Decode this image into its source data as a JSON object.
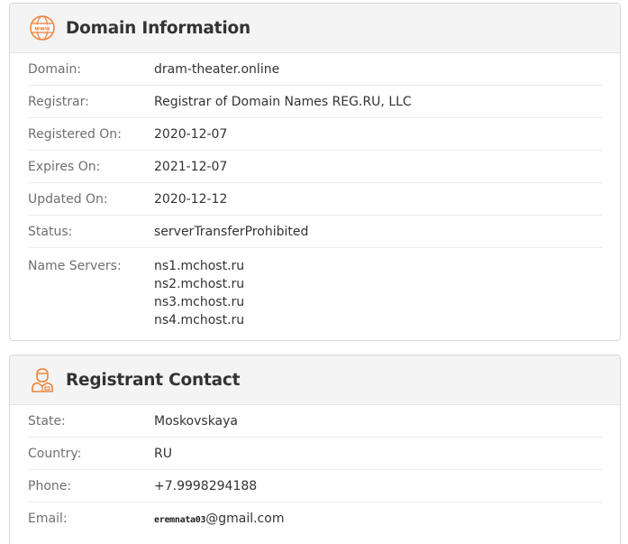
{
  "domain_card": {
    "title": "Domain Information",
    "icon": "www-globe-icon",
    "rows": [
      {
        "label": "Domain:",
        "value": "dram-theater.online"
      },
      {
        "label": "Registrar:",
        "value": "Registrar of Domain Names REG.RU, LLC"
      },
      {
        "label": "Registered On:",
        "value": "2020-12-07"
      },
      {
        "label": "Expires On:",
        "value": "2021-12-07"
      },
      {
        "label": "Updated On:",
        "value": "2020-12-12"
      },
      {
        "label": "Status:",
        "value": "serverTransferProhibited"
      }
    ],
    "name_servers": {
      "label": "Name Servers:",
      "values": [
        "ns1.mchost.ru",
        "ns2.mchost.ru",
        "ns3.mchost.ru",
        "ns4.mchost.ru"
      ]
    }
  },
  "registrant_card": {
    "title": "Registrant Contact",
    "icon": "person-icon",
    "rows": [
      {
        "label": "State:",
        "value": "Moskovskaya"
      },
      {
        "label": "Country:",
        "value": "RU"
      },
      {
        "label": "Phone:",
        "value": "+7.9998294188"
      }
    ],
    "email": {
      "label": "Email:",
      "user": "eremnata03",
      "domain": "@gmail.com"
    }
  },
  "colors": {
    "accent": "#f0833a",
    "header_bg": "#f4f4f4",
    "label": "#6f6f6f",
    "value": "#333333"
  }
}
